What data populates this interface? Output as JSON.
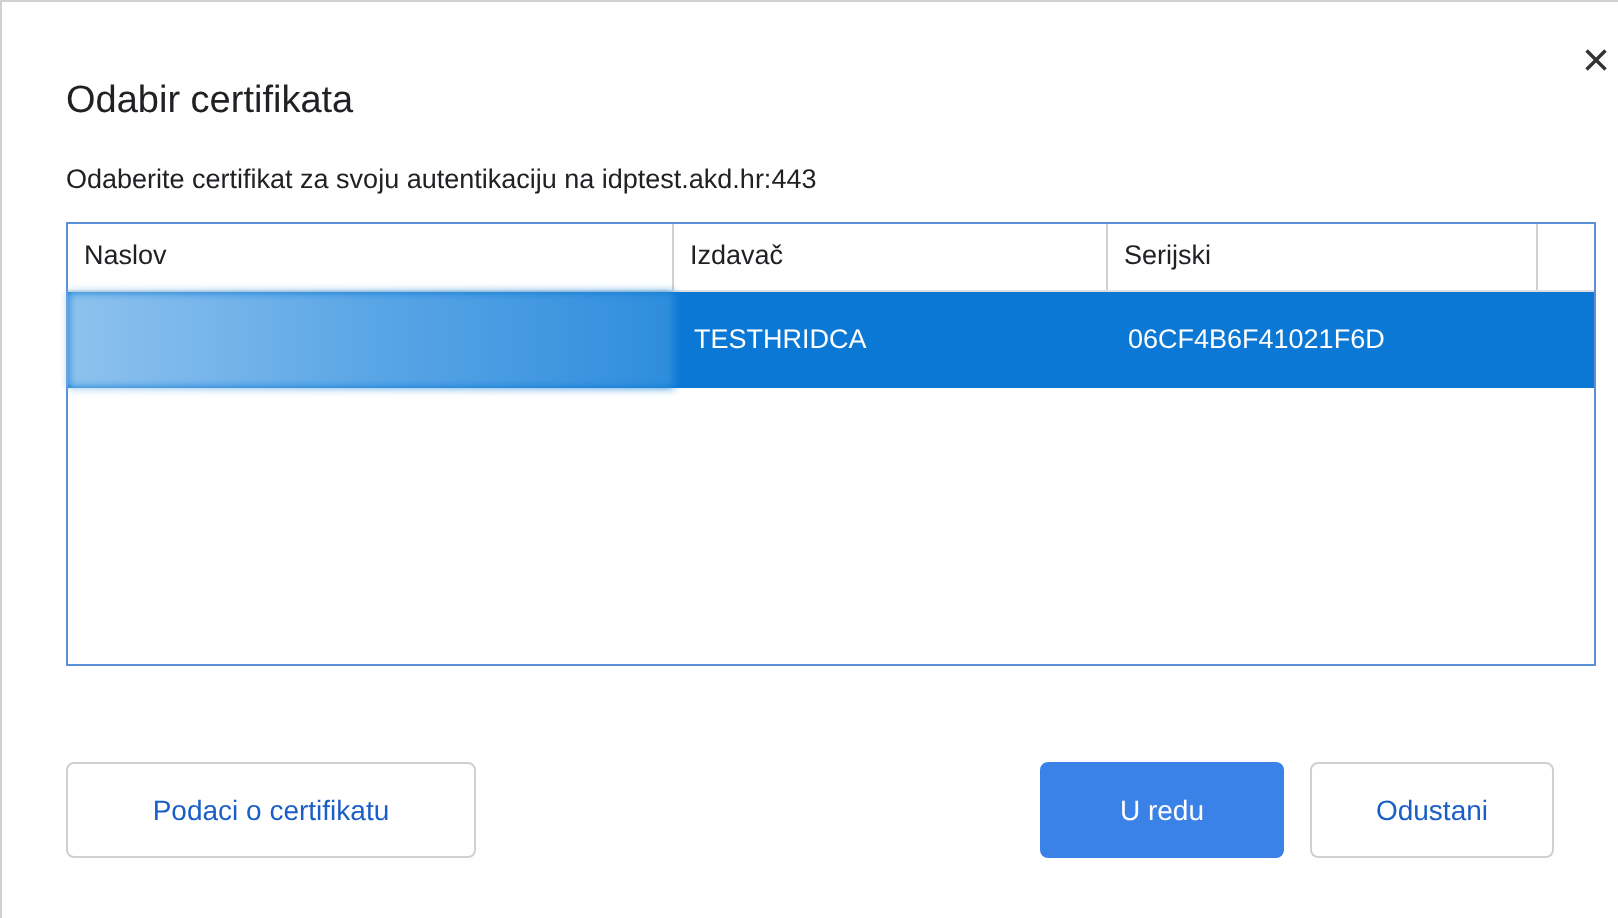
{
  "dialog": {
    "title": "Odabir certifikata",
    "close": "×",
    "message": "Odaberite certifikat za svoju autentikaciju na idptest.akd.hr:443"
  },
  "table": {
    "columns": [
      "Naslov",
      "Izdavač",
      "Serijski"
    ],
    "rows": [
      {
        "selected": true,
        "naslov": {
          "kind": "redacted"
        },
        "izdavac": "TESTHRIDCA",
        "serijski": "06CF4B6F41021F6D"
      }
    ]
  },
  "buttons": [
    {
      "label": "Podaci o certifikatu",
      "kind": "secondary"
    },
    {
      "label": "U redu",
      "kind": "primary"
    },
    {
      "label": "Odustani",
      "kind": "secondary"
    }
  ]
}
